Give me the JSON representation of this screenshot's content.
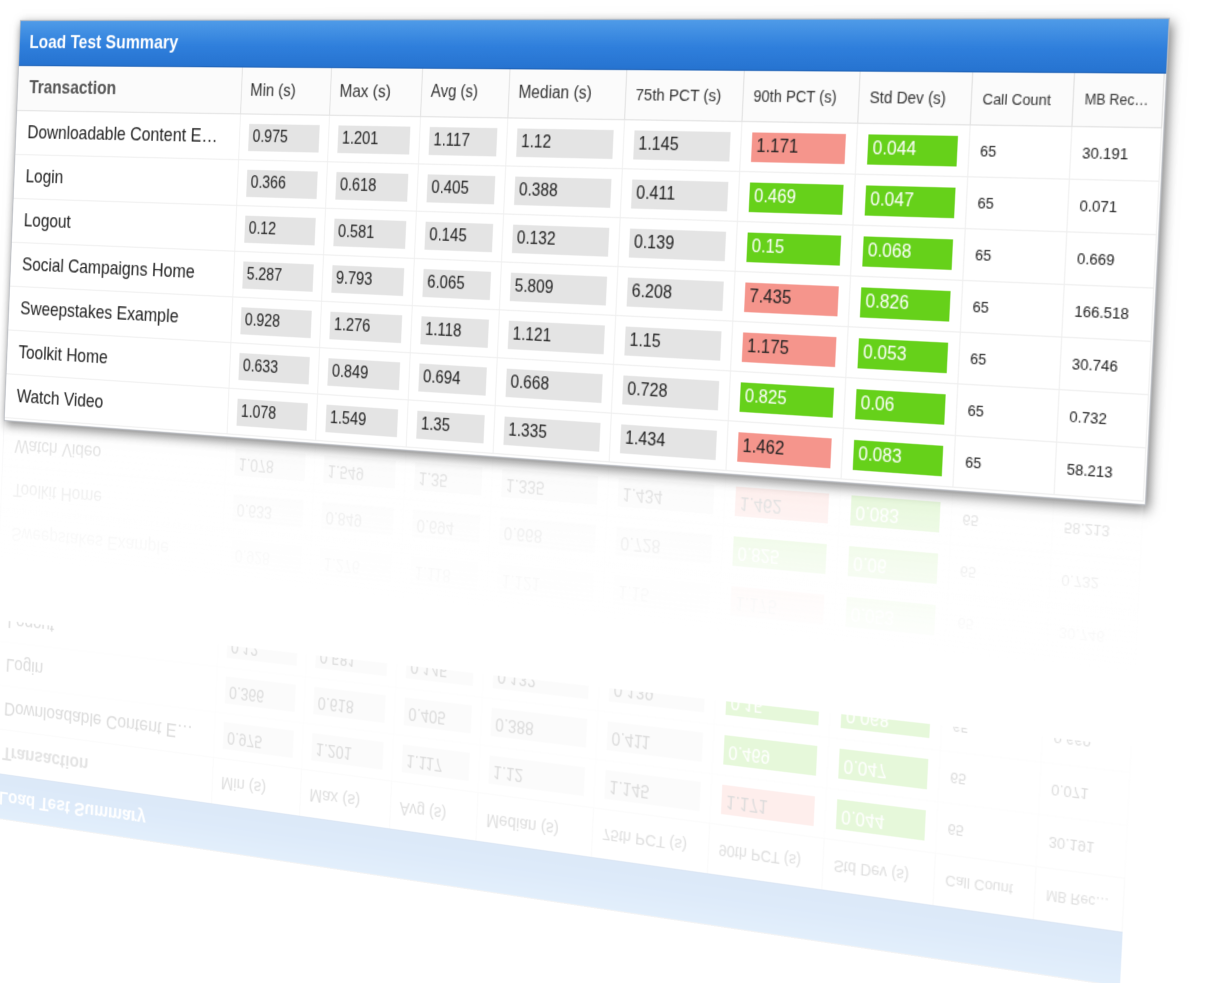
{
  "title": "Load Test Summary",
  "columns": [
    "Transaction",
    "Min (s)",
    "Max (s)",
    "Avg (s)",
    "Median (s)",
    "75th PCT (s)",
    "90th PCT (s)",
    "Std Dev (s)",
    "Call Count",
    "MB Receiv…"
  ],
  "rows": [
    {
      "name": "Downloadable Content E…",
      "min": "0.975",
      "max": "1.201",
      "avg": "1.117",
      "median": "1.12",
      "p75": "1.145",
      "p90": "1.171",
      "p90_status": "red",
      "std": "0.044",
      "std_status": "green",
      "calls": "65",
      "mb": "30.191"
    },
    {
      "name": "Login",
      "min": "0.366",
      "max": "0.618",
      "avg": "0.405",
      "median": "0.388",
      "p75": "0.411",
      "p90": "0.469",
      "p90_status": "green",
      "std": "0.047",
      "std_status": "green",
      "calls": "65",
      "mb": "0.071"
    },
    {
      "name": "Logout",
      "min": "0.12",
      "max": "0.581",
      "avg": "0.145",
      "median": "0.132",
      "p75": "0.139",
      "p90": "0.15",
      "p90_status": "green",
      "std": "0.068",
      "std_status": "green",
      "calls": "65",
      "mb": "0.669"
    },
    {
      "name": "Social Campaigns Home",
      "min": "5.287",
      "max": "9.793",
      "avg": "6.065",
      "median": "5.809",
      "p75": "6.208",
      "p90": "7.435",
      "p90_status": "red",
      "std": "0.826",
      "std_status": "green",
      "calls": "65",
      "mb": "166.518"
    },
    {
      "name": "Sweepstakes Example",
      "min": "0.928",
      "max": "1.276",
      "avg": "1.118",
      "median": "1.121",
      "p75": "1.15",
      "p90": "1.175",
      "p90_status": "red",
      "std": "0.053",
      "std_status": "green",
      "calls": "65",
      "mb": "30.746"
    },
    {
      "name": "Toolkit Home",
      "min": "0.633",
      "max": "0.849",
      "avg": "0.694",
      "median": "0.668",
      "p75": "0.728",
      "p90": "0.825",
      "p90_status": "green",
      "std": "0.06",
      "std_status": "green",
      "calls": "65",
      "mb": "0.732"
    },
    {
      "name": "Watch Video",
      "min": "1.078",
      "max": "1.549",
      "avg": "1.35",
      "median": "1.335",
      "p75": "1.434",
      "p90": "1.462",
      "p90_status": "red",
      "std": "0.083",
      "std_status": "green",
      "calls": "65",
      "mb": "58.213"
    }
  ],
  "colors": {
    "header_blue": "#2f7fdc",
    "status_red": "#f5958c",
    "status_green": "#66d11a",
    "cell_gray": "#e4e4e4"
  }
}
